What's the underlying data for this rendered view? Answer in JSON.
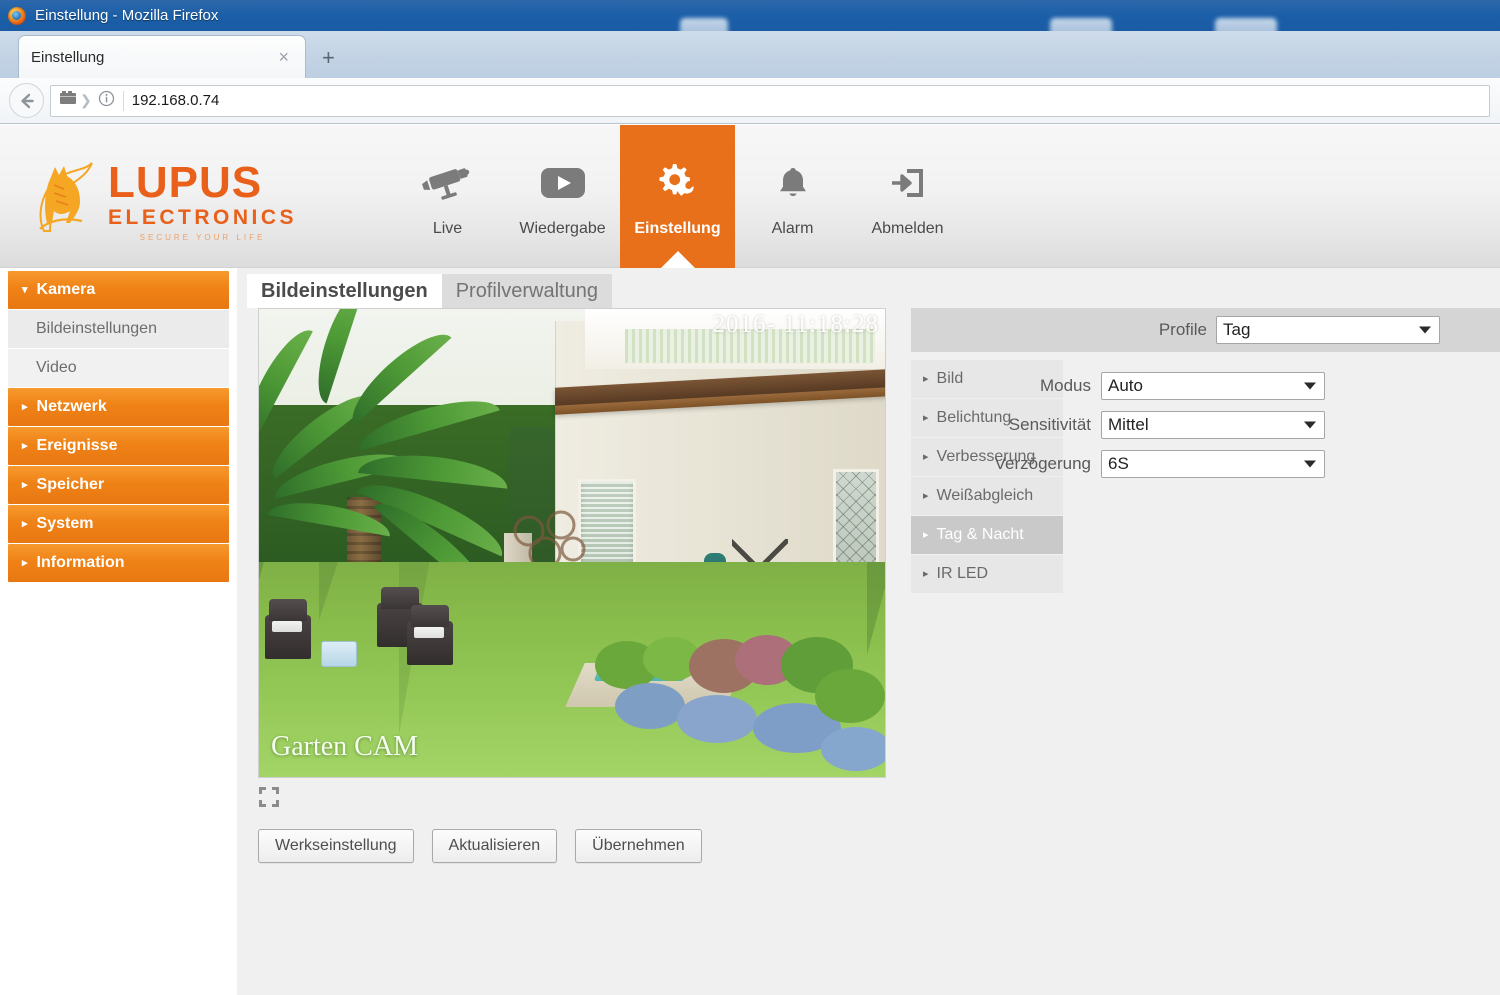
{
  "browser": {
    "window_title": "Einstellung - Mozilla Firefox",
    "tab_label": "Einstellung",
    "tab_close_glyph": "×",
    "new_tab_glyph": "+",
    "url": "192.168.0.74",
    "back_icon": "back-arrow-icon",
    "page_icon": "page-icon",
    "info_icon": "info-icon"
  },
  "header": {
    "logo": {
      "brand": "LUPUS",
      "sub": "ELECTRONICS",
      "tagline": "SECURE YOUR LIFE",
      "accent": "#e8601a"
    },
    "nav": [
      {
        "label": "Live",
        "icon": "cctv-camera-icon",
        "active": false
      },
      {
        "label": "Wiedergabe",
        "icon": "play-icon",
        "active": false
      },
      {
        "label": "Einstellung",
        "icon": "gear-wrench-icon",
        "active": true
      },
      {
        "label": "Alarm",
        "icon": "bell-icon",
        "active": false
      },
      {
        "label": "Abmelden",
        "icon": "logout-icon",
        "active": false
      }
    ]
  },
  "sidebar": {
    "items": [
      {
        "label": "Kamera",
        "type": "group",
        "expanded": true,
        "caret": "▾"
      },
      {
        "label": "Bildeinstellungen",
        "type": "sub",
        "active": true
      },
      {
        "label": "Video",
        "type": "sub",
        "active": false
      },
      {
        "label": "Netzwerk",
        "type": "group",
        "expanded": false,
        "caret": "▸"
      },
      {
        "label": "Ereignisse",
        "type": "group",
        "expanded": false,
        "caret": "▸"
      },
      {
        "label": "Speicher",
        "type": "group",
        "expanded": false,
        "caret": "▸"
      },
      {
        "label": "System",
        "type": "group",
        "expanded": false,
        "caret": "▸"
      },
      {
        "label": "Information",
        "type": "group",
        "expanded": false,
        "caret": "▸"
      }
    ]
  },
  "main": {
    "tabs": [
      {
        "label": "Bildeinstellungen",
        "active": true
      },
      {
        "label": "Profilverwaltung",
        "active": false
      }
    ],
    "video": {
      "timestamp": "2016-        11:18:28",
      "camera_name": "Garten CAM",
      "fullscreen_icon": "fullscreen-icon"
    },
    "buttons": [
      {
        "label": "Werkseinstellung"
      },
      {
        "label": "Aktualisieren"
      },
      {
        "label": "Übernehmen"
      }
    ],
    "accordion": [
      {
        "label": "Bild",
        "selected": false,
        "caret": "▸"
      },
      {
        "label": "Belichtung",
        "selected": false,
        "caret": "▸"
      },
      {
        "label": "Verbesserung",
        "selected": false,
        "caret": "▸"
      },
      {
        "label": "Weißabgleich",
        "selected": false,
        "caret": "▸"
      },
      {
        "label": "Tag & Nacht",
        "selected": true,
        "caret": "▸"
      },
      {
        "label": "IR LED",
        "selected": false,
        "caret": "▸"
      }
    ],
    "form": {
      "profile": {
        "label": "Profile",
        "value": "Tag"
      },
      "fields": [
        {
          "label": "Modus",
          "value": "Auto"
        },
        {
          "label": "Sensitivität",
          "value": "Mittel"
        },
        {
          "label": "Verzögerung",
          "value": "6S"
        }
      ]
    }
  }
}
